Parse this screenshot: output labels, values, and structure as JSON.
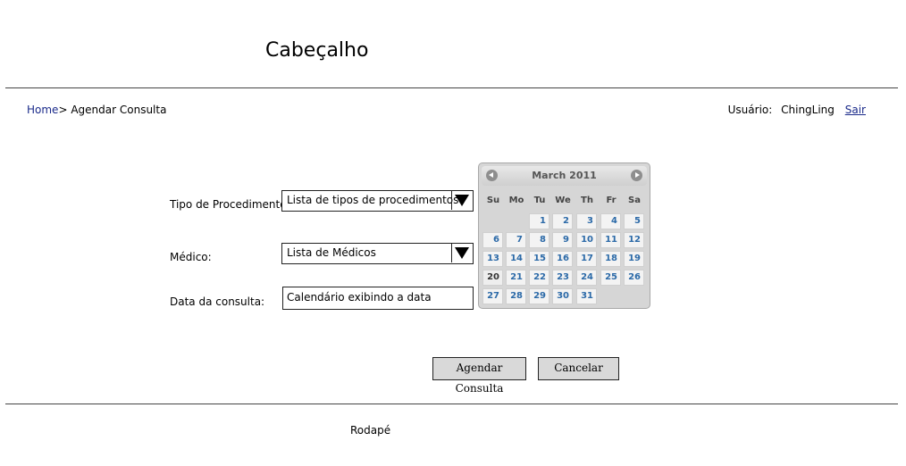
{
  "header": {
    "title": "Cabeçalho"
  },
  "breadcrumb": {
    "home": "Home",
    "separator": ">",
    "current": "Agendar Consulta"
  },
  "user": {
    "label": "Usuário:",
    "name": "ChingLing",
    "logout": "Sair"
  },
  "form": {
    "procedure_label": "Tipo de Procedimento:",
    "procedure_value": "Lista de tipos de procedimentos",
    "doctor_label": "Médico:",
    "doctor_value": "Lista de Médicos",
    "date_label": "Data da consulta:",
    "date_value": "Calendário exibindo a data"
  },
  "calendar": {
    "month_year": "March 2011",
    "weekdays": [
      "Su",
      "Mo",
      "Tu",
      "We",
      "Th",
      "Fr",
      "Sa"
    ],
    "first_weekday_index": 2,
    "days_in_month": 31,
    "highlighted_day": 20
  },
  "buttons": {
    "submit": "Agendar Consulta",
    "cancel": "Cancelar"
  },
  "footer": {
    "text": "Rodapé"
  }
}
